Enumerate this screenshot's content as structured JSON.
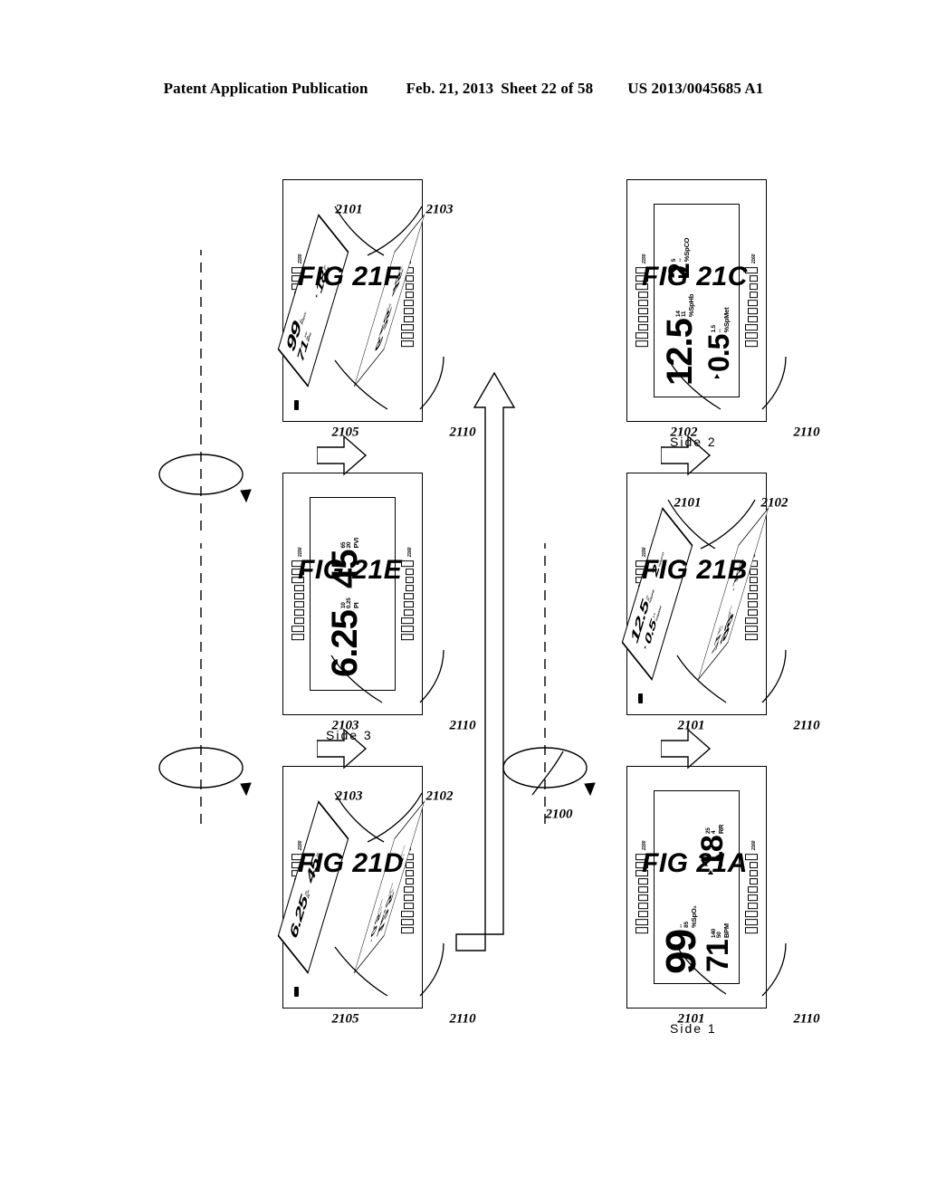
{
  "header": {
    "publication": "Patent Application Publication",
    "date": "Feb. 21, 2013",
    "sheet": "Sheet 22 of 58",
    "number": "US 2013/0045685 A1"
  },
  "figures": [
    {
      "id": "fig21a",
      "label": "FIG 21A",
      "side_label": "Side 1",
      "refs": [
        "2110",
        "2101"
      ],
      "view": "flat",
      "screen_side": "side1"
    },
    {
      "id": "fig21b",
      "label": "FIG 21B",
      "side_label": "",
      "refs": [
        "2110",
        "2101",
        "2102",
        "2101",
        "2100"
      ],
      "view": "cube",
      "cube_top": "side2",
      "cube_front": "side1"
    },
    {
      "id": "fig21c",
      "label": "FIG 21C",
      "side_label": "Side 2",
      "refs": [
        "2110",
        "2102"
      ],
      "view": "flat",
      "screen_side": "side2"
    },
    {
      "id": "fig21d",
      "label": "FIG 21D",
      "side_label": "",
      "refs": [
        "2110",
        "2105",
        "2103",
        "2102"
      ],
      "view": "cube",
      "cube_top": "side3",
      "cube_front": "side2"
    },
    {
      "id": "fig21e",
      "label": "FIG 21E",
      "side_label": "Side 3",
      "refs": [
        "2110",
        "2103"
      ],
      "view": "flat",
      "screen_side": "side3"
    },
    {
      "id": "fig21f",
      "label": "FIG 21F",
      "side_label": "",
      "refs": [
        "2110",
        "2105",
        "2101",
        "2103"
      ],
      "view": "cube",
      "cube_top": "side1",
      "cube_front": "side3"
    }
  ],
  "screens": {
    "side1": {
      "name": "Side 1",
      "readings": [
        {
          "value": "99",
          "limit_high": "--",
          "limit_low": "85",
          "unit": "%SpO₂",
          "size": 46,
          "arrow": false
        },
        {
          "value": "71",
          "limit_high": "140",
          "limit_low": "50",
          "unit": "BPM",
          "size": 34,
          "arrow": false
        },
        {
          "value": "18",
          "limit_high": "25",
          "limit_low": "4",
          "unit": "RR",
          "size": 34,
          "arrow": true
        }
      ]
    },
    "side2": {
      "name": "Side 2",
      "readings": [
        {
          "value": "12.5",
          "limit_high": "14",
          "limit_low": "11",
          "unit": "%SpHb",
          "size": 40,
          "arrow": false
        },
        {
          "value": "0.5",
          "limit_high": "1.5",
          "limit_low": "--",
          "unit": "%SpMet",
          "size": 32,
          "arrow": true
        },
        {
          "value": "2",
          "limit_high": "5",
          "limit_low": "--",
          "unit": "%SpCO",
          "size": 32,
          "arrow": false
        }
      ]
    },
    "side3": {
      "name": "Side 3",
      "readings": [
        {
          "value": "6.25",
          "limit_high": "10",
          "limit_low": "0.25",
          "unit": "PI",
          "size": 40,
          "arrow": false
        },
        {
          "value": "45",
          "limit_high": "65",
          "limit_low": "20",
          "unit": "PVI",
          "size": 40,
          "arrow": false
        }
      ]
    }
  },
  "device": {
    "ref_housing": "2110",
    "ref_display_side1": "2101",
    "ref_display_side2": "2102",
    "ref_display_side3": "2103",
    "ref_indicator": "2105",
    "ref_rotation": "2100",
    "bar_label_top": "2150",
    "bar_label_bottom": "2160"
  }
}
